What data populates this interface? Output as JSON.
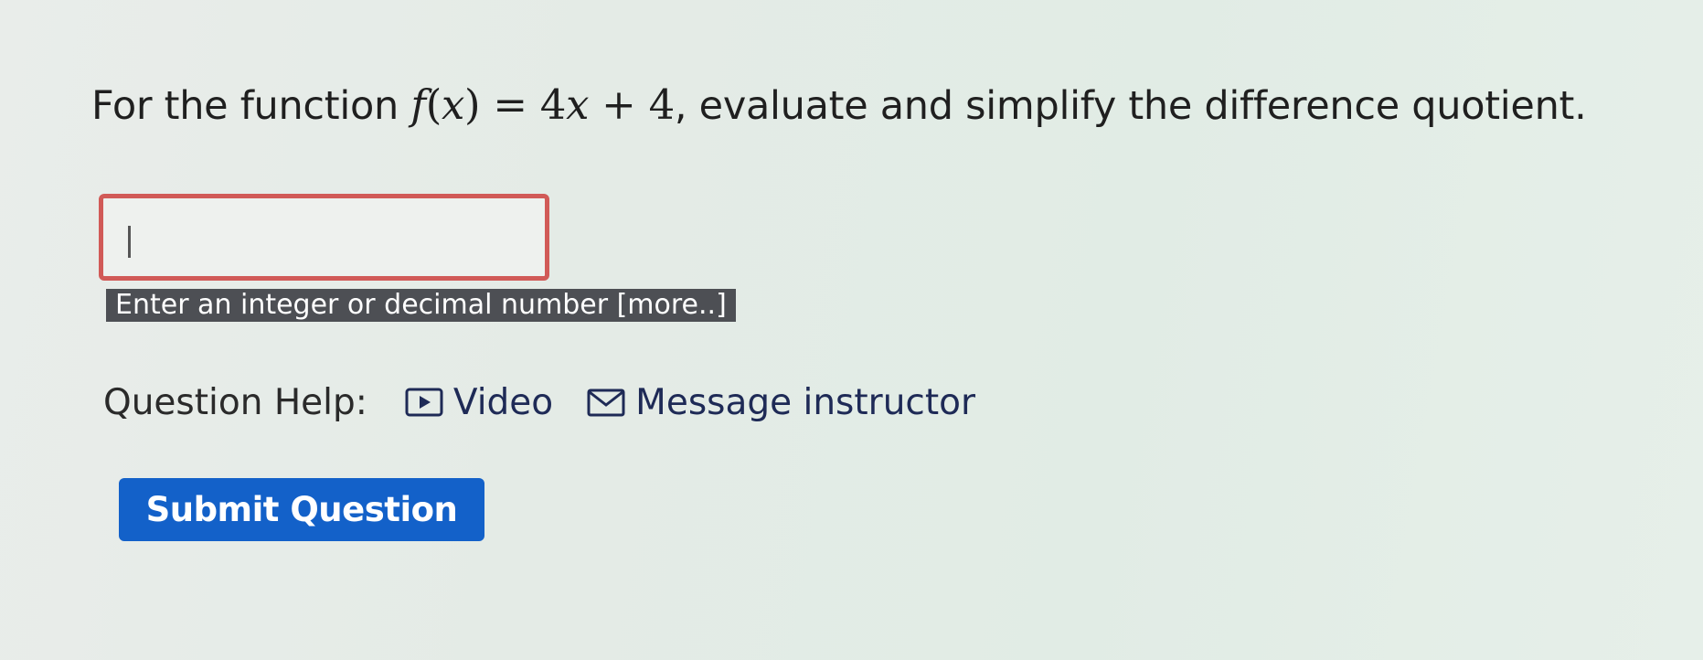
{
  "question": {
    "prefix": "For the function ",
    "func_name": "f",
    "open_paren": "(",
    "var": "x",
    "close_paren": ")",
    "equals": " = ",
    "expression": "4",
    "expression_var": "x",
    "expression_rest": " + 4",
    "suffix": ", evaluate and simplify the difference quotient."
  },
  "answer": {
    "value": "",
    "placeholder": ""
  },
  "hint": {
    "text": "Enter an integer or decimal number ",
    "more_link": "[more..]"
  },
  "help": {
    "label": "Question Help:",
    "video_label": "Video",
    "message_label": "Message instructor",
    "video_icon": "video-play-icon",
    "message_icon": "envelope-icon"
  },
  "submit": {
    "label": "Submit Question"
  },
  "colors": {
    "submit_bg": "#1361c9",
    "answer_border": "#d15a57",
    "hint_bg": "#4d4f54",
    "link": "#1e2a56"
  }
}
